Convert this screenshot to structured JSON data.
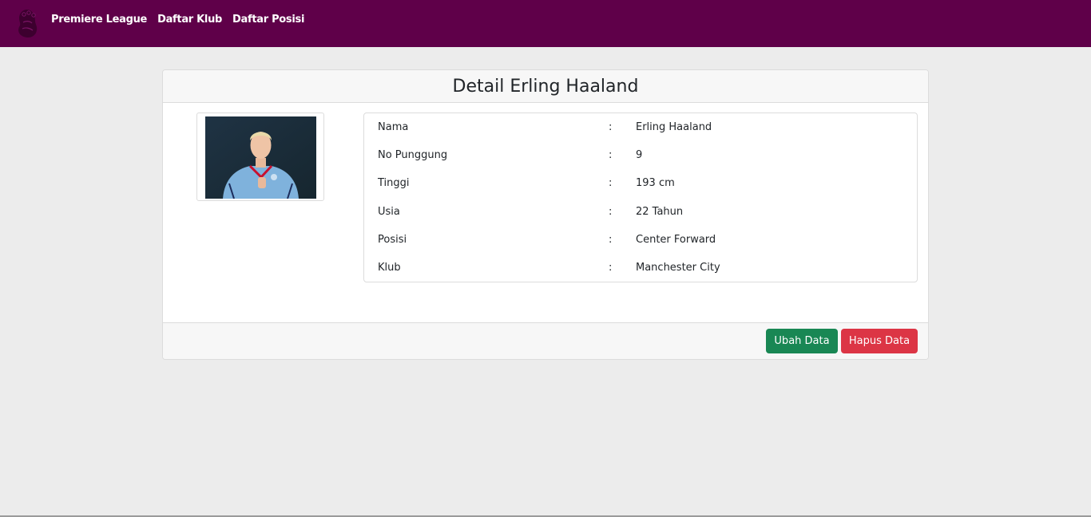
{
  "navbar": {
    "logo_icon": "premier-league-lion-icon",
    "links": [
      "Premiere League",
      "Daftar Klub",
      "Daftar Posisi"
    ],
    "background": "#5f0049"
  },
  "card": {
    "title": "Detail Erling Haaland",
    "photo_icon": "player-photo",
    "rows": [
      {
        "label": "Nama",
        "sep": ":",
        "value": "Erling Haaland"
      },
      {
        "label": "No Punggung",
        "sep": ":",
        "value": "9"
      },
      {
        "label": "Tinggi",
        "sep": ":",
        "value": "193 cm"
      },
      {
        "label": "Usia",
        "sep": ":",
        "value": "22 Tahun"
      },
      {
        "label": "Posisi",
        "sep": ":",
        "value": "Center Forward"
      },
      {
        "label": "Klub",
        "sep": ":",
        "value": "Manchester City"
      }
    ],
    "buttons": {
      "edit_label": "Ubah Data",
      "delete_label": "Hapus Data"
    }
  },
  "colors": {
    "primary_nav": "#5f0049",
    "success": "#198754",
    "danger": "#dc3545"
  }
}
